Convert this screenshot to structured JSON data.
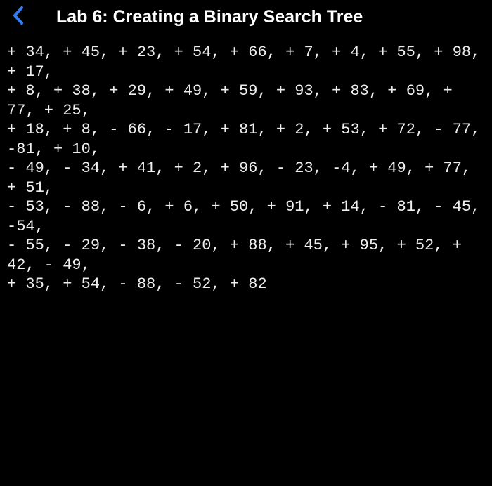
{
  "header": {
    "title": "Lab 6: Creating a Binary Search Tree"
  },
  "content": {
    "text": "+ 34, + 45, + 23, + 54, + 66, + 7, + 4, + 55, + 98, + 17,\n+ 8, + 38, + 29, + 49, + 59, + 93, + 83, + 69, + 77, + 25,\n+ 18, + 8, - 66, - 17, + 81, + 2, + 53, + 72, - 77, -81, + 10,\n- 49, - 34, + 41, + 2, + 96, - 23, -4, + 49, + 77, + 51,\n- 53, - 88, - 6, + 6, + 50, + 91, + 14, - 81, - 45, -54,\n- 55, - 29, - 38, - 20, + 88, + 45, + 95, + 52, + 42, - 49,\n+ 35, + 54, - 88, - 52, + 82"
  }
}
